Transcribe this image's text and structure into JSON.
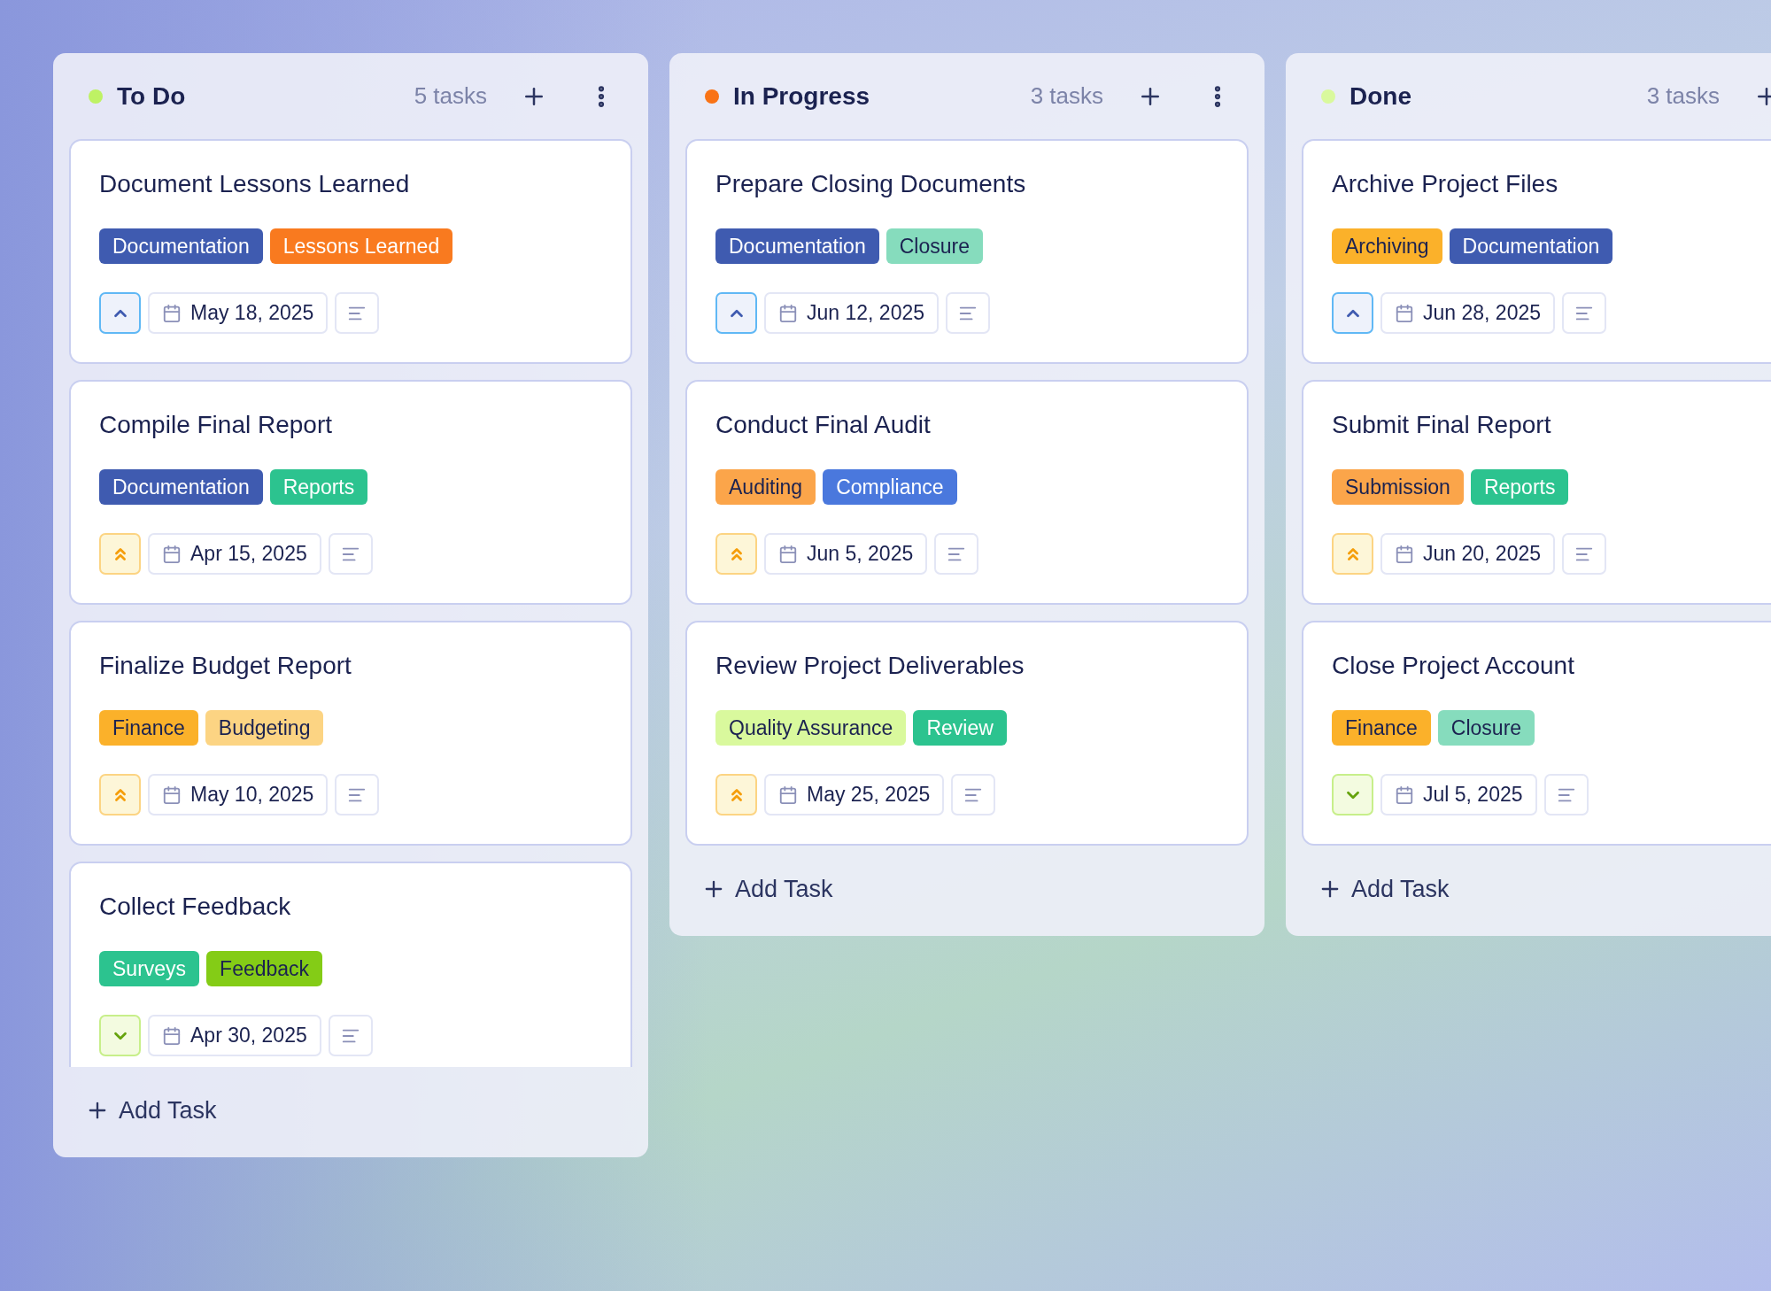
{
  "columns": [
    {
      "title": "To Do",
      "color": "#bef264",
      "count": "5 tasks",
      "add_label": "Add Task",
      "cards": [
        {
          "title": "Document Lessons Learned",
          "kind": "medium",
          "date": "May 18, 2025",
          "tags": [
            {
              "label": "Documentation",
              "color": "#3f5bb0"
            },
            {
              "label": "Lessons Learned",
              "color": "#f97a1f"
            }
          ]
        },
        {
          "title": "Compile Final Report",
          "kind": "high",
          "date": "Apr 15, 2025",
          "tags": [
            {
              "label": "Documentation",
              "color": "#3f5bb0"
            },
            {
              "label": "Reports",
              "color": "#2cc38f"
            }
          ]
        },
        {
          "title": "Finalize Budget Report",
          "kind": "high",
          "date": "May 10, 2025",
          "tags": [
            {
              "label": "Finance",
              "color": "#fbb12a"
            },
            {
              "label": "Budgeting",
              "color": "#fcd483"
            }
          ]
        },
        {
          "title": "Collect Feedback",
          "kind": "low",
          "date": "Apr 30, 2025",
          "tags": [
            {
              "label": "Surveys",
              "color": "#2cc38f"
            },
            {
              "label": "Feedback",
              "color": "#84cc16"
            }
          ]
        }
      ]
    },
    {
      "title": "In Progress",
      "color": "#f97316",
      "count": "3 tasks",
      "add_label": "Add Task",
      "cards": [
        {
          "title": "Prepare Closing Documents",
          "kind": "medium",
          "date": "Jun 12, 2025",
          "tags": [
            {
              "label": "Documentation",
              "color": "#3f5bb0"
            },
            {
              "label": "Closure",
              "color": "#86dcbd"
            }
          ]
        },
        {
          "title": "Conduct Final Audit",
          "kind": "high",
          "date": "Jun 5, 2025",
          "tags": [
            {
              "label": "Auditing",
              "color": "#fba54a"
            },
            {
              "label": "Compliance",
              "color": "#4a78dd"
            }
          ]
        },
        {
          "title": "Review Project Deliverables",
          "kind": "high",
          "date": "May 25, 2025",
          "tags": [
            {
              "label": "Quality Assurance",
              "color": "#d9f99d"
            },
            {
              "label": "Review",
              "color": "#2cc38f"
            }
          ]
        }
      ]
    },
    {
      "title": "Done",
      "color": "#d9f99d",
      "count": "3 tasks",
      "add_label": "Add Task",
      "cards": [
        {
          "title": "Archive Project Files",
          "kind": "medium",
          "date": "Jun 28, 2025",
          "tags": [
            {
              "label": "Archiving",
              "color": "#fbb12a"
            },
            {
              "label": "Documentation",
              "color": "#3f5bb0"
            }
          ]
        },
        {
          "title": "Submit Final Report",
          "kind": "high",
          "date": "Jun 20, 2025",
          "tags": [
            {
              "label": "Submission",
              "color": "#fba54a"
            },
            {
              "label": "Reports",
              "color": "#2cc38f"
            }
          ]
        },
        {
          "title": "Close Project Account",
          "kind": "low",
          "date": "Jul 5, 2025",
          "tags": [
            {
              "label": "Finance",
              "color": "#fbb12a"
            },
            {
              "label": "Closure",
              "color": "#86dcbd"
            }
          ]
        }
      ]
    }
  ]
}
